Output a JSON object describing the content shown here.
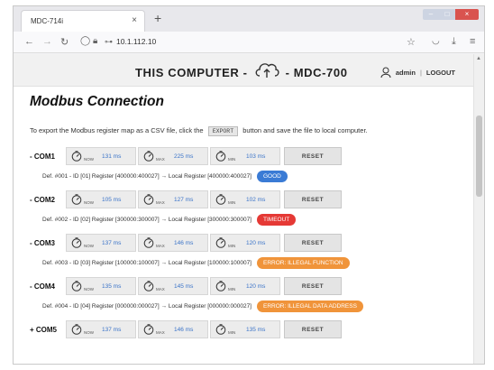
{
  "browser": {
    "tab_title": "MDC-714i",
    "tab_close": "×",
    "new_tab": "+",
    "url": "10.1.112.10"
  },
  "header": {
    "left_text": "THIS COMPUTER -",
    "right_text": "- MDC-700",
    "user": "admin",
    "separator": "|",
    "logout": "LOGOUT"
  },
  "page": {
    "title": "Modbus Connection",
    "intro_before": "To export the Modbus register map as a CSV file, click the",
    "export_label": "EXPORT",
    "intro_after": "button and save the file to local computer."
  },
  "colors": {
    "good": "#3a7bd5",
    "timeout": "#e53935",
    "error": "#f0943a"
  },
  "rows": [
    {
      "name": "- COM1",
      "now": "131 ms",
      "max": "225 ms",
      "min": "103 ms",
      "reset": "RESET",
      "def": "Def. #001 - ID [01] Register [400000:400027] → Local Register [400000:400027]",
      "status": "GOOD",
      "status_color": "#3a7bd5"
    },
    {
      "name": "- COM2",
      "now": "105 ms",
      "max": "127 ms",
      "min": "102 ms",
      "reset": "RESET",
      "def": "Def. #002 - ID [02] Register [300000:300007] → Local Register [300000:300007]",
      "status": "TIMEOUT",
      "status_color": "#e53935"
    },
    {
      "name": "- COM3",
      "now": "137 ms",
      "max": "146 ms",
      "min": "120 ms",
      "reset": "RESET",
      "def": "Def. #003 - ID [03] Register [100000:100007] → Local Register [100000:100007]",
      "status": "ERROR: ILLEGAL FUNCTION",
      "status_color": "#f0943a"
    },
    {
      "name": "- COM4",
      "now": "135 ms",
      "max": "145 ms",
      "min": "120 ms",
      "reset": "RESET",
      "def": "Def. #004 - ID [04] Register [000000:000027] → Local Register [000000:000027]",
      "status": "ERROR: ILLEGAL DATA ADDRESS",
      "status_color": "#f0943a"
    },
    {
      "name": "+ COM5",
      "now": "137 ms",
      "max": "146 ms",
      "min": "135 ms",
      "reset": "RESET"
    }
  ],
  "labels": {
    "now": "NOW",
    "max": "MAX",
    "min": "MIN"
  }
}
